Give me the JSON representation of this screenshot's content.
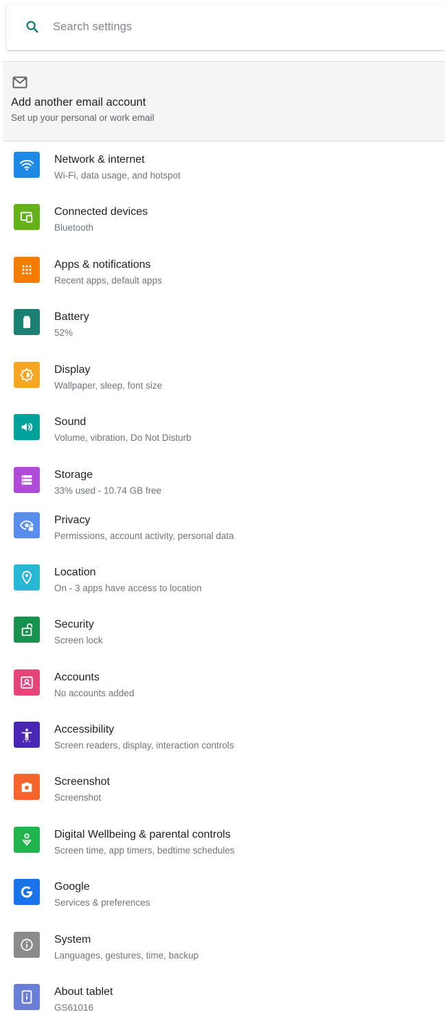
{
  "search": {
    "placeholder": "Search settings"
  },
  "suggestion": {
    "title": "Add another email account",
    "subtitle": "Set up your personal or work email"
  },
  "settings": [
    {
      "label": "Network & internet",
      "sub": "Wi-Fi, data usage, and hotspot",
      "color": "#1e88e5",
      "icon": "wifi-icon"
    },
    {
      "label": "Connected devices",
      "sub": "Bluetooth",
      "color": "#64b11a",
      "icon": "devices-icon"
    },
    {
      "label": "Apps & notifications",
      "sub": "Recent apps, default apps",
      "color": "#f57c00",
      "icon": "apps-grid-icon"
    },
    {
      "label": "Battery",
      "sub": "52%",
      "color": "#1b7f73",
      "icon": "battery-icon"
    },
    {
      "label": "Display",
      "sub": "Wallpaper, sleep, font size",
      "color": "#f5a623",
      "icon": "brightness-icon"
    },
    {
      "label": "Sound",
      "sub": "Volume, vibration, Do Not Disturb",
      "color": "#00a39b",
      "icon": "volume-icon"
    },
    {
      "label": "Storage",
      "sub": "33% used - 10.74 GB free",
      "color": "#b04ad8",
      "icon": "storage-icon"
    },
    {
      "label": "Privacy",
      "sub": "Permissions, account activity, personal data",
      "color": "#5b8def",
      "icon": "privacy-eye-icon"
    },
    {
      "label": "Location",
      "sub": "On - 3 apps have access to location",
      "color": "#27b6d6",
      "icon": "location-pin-icon"
    },
    {
      "label": "Security",
      "sub": "Screen lock",
      "color": "#17914e",
      "icon": "lock-icon"
    },
    {
      "label": "Accounts",
      "sub": "No accounts added",
      "color": "#e6457a",
      "icon": "account-icon"
    },
    {
      "label": "Accessibility",
      "sub": "Screen readers, display, interaction controls",
      "color": "#4a26b5",
      "icon": "accessibility-icon"
    },
    {
      "label": "Screenshot",
      "sub": "Screenshot",
      "color": "#f4642b",
      "icon": "camera-icon"
    },
    {
      "label": "Digital Wellbeing & parental controls",
      "sub": "Screen time, app timers, bedtime schedules",
      "color": "#21b44c",
      "icon": "wellbeing-icon"
    },
    {
      "label": "Google",
      "sub": "Services & preferences",
      "color": "#1a73e8",
      "icon": "google-icon"
    },
    {
      "label": "System",
      "sub": "Languages, gestures, time, backup",
      "color": "#8a8a8a",
      "icon": "info-icon"
    },
    {
      "label": "About tablet",
      "sub": "GS61016",
      "color": "#6b7ed6",
      "icon": "tablet-icon"
    }
  ]
}
